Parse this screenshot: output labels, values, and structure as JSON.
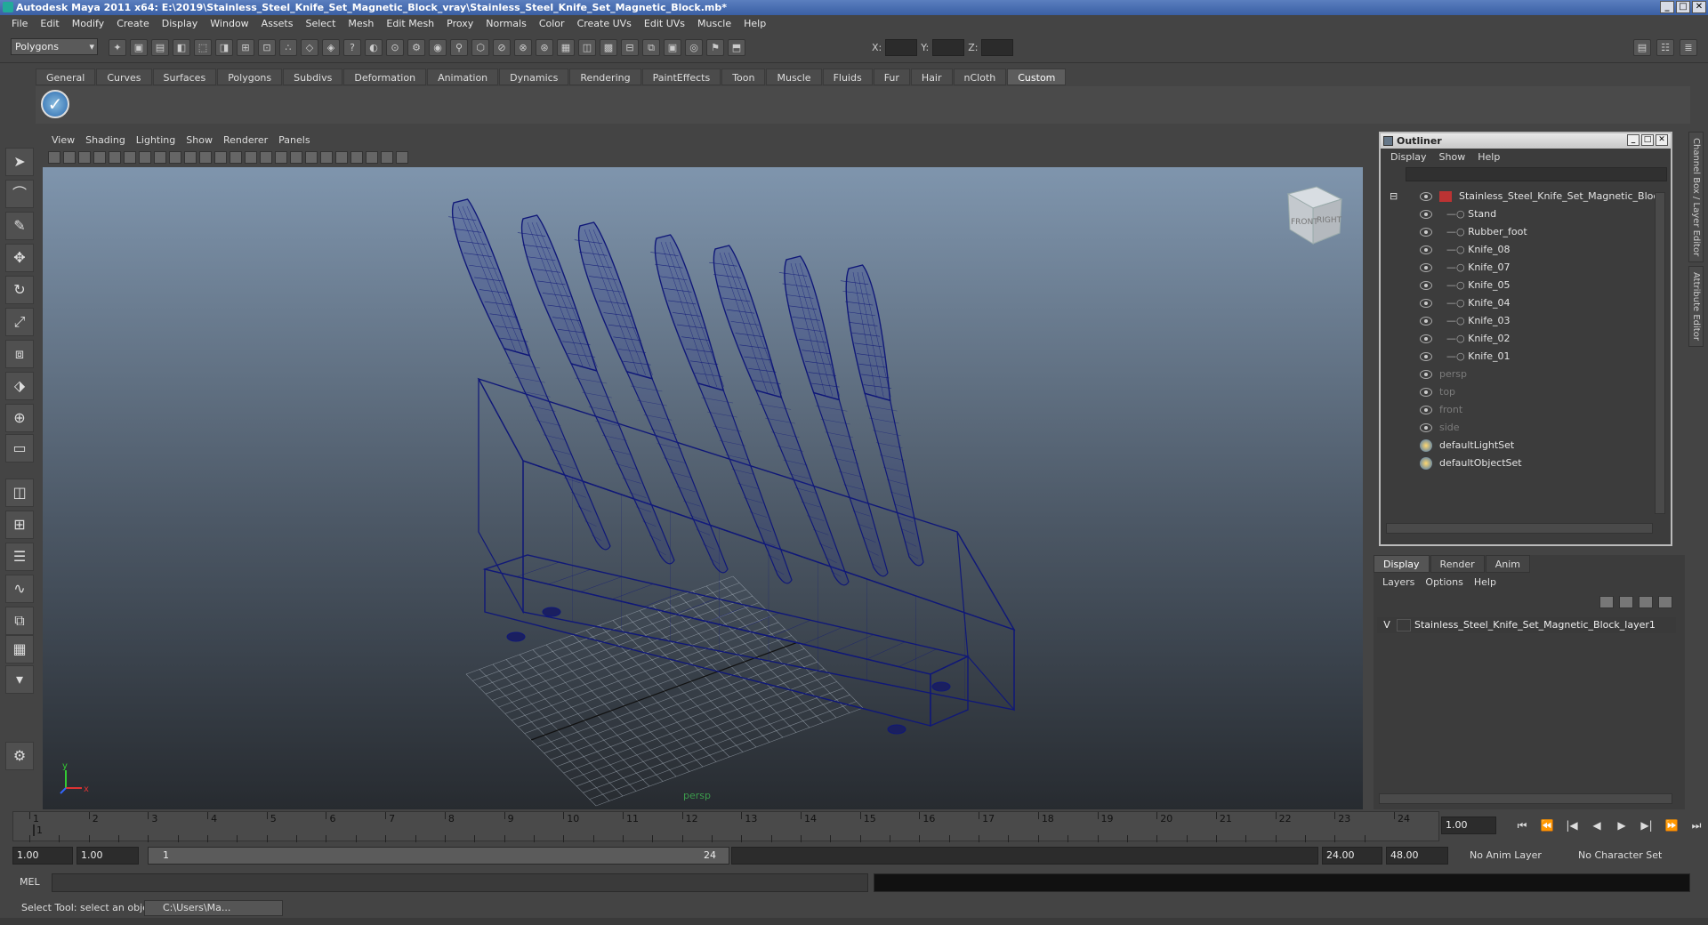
{
  "window": {
    "title": "Autodesk Maya 2011 x64: E:\\2019\\Stainless_Steel_Knife_Set_Magnetic_Block_vray\\Stainless_Steel_Knife_Set_Magnetic_Block.mb*"
  },
  "menubar": [
    "File",
    "Edit",
    "Modify",
    "Create",
    "Display",
    "Window",
    "Assets",
    "Select",
    "Mesh",
    "Edit Mesh",
    "Proxy",
    "Normals",
    "Color",
    "Create UVs",
    "Edit UVs",
    "Muscle",
    "Help"
  ],
  "toolbar": {
    "mode": "Polygons",
    "x_label": "X:",
    "y_label": "Y:",
    "z_label": "Z:"
  },
  "shelf_tabs": [
    {
      "label": "General",
      "active": false
    },
    {
      "label": "Curves",
      "active": false
    },
    {
      "label": "Surfaces",
      "active": false
    },
    {
      "label": "Polygons",
      "active": false
    },
    {
      "label": "Subdivs",
      "active": false
    },
    {
      "label": "Deformation",
      "active": false
    },
    {
      "label": "Animation",
      "active": false
    },
    {
      "label": "Dynamics",
      "active": false
    },
    {
      "label": "Rendering",
      "active": false
    },
    {
      "label": "PaintEffects",
      "active": false
    },
    {
      "label": "Toon",
      "active": false
    },
    {
      "label": "Muscle",
      "active": false
    },
    {
      "label": "Fluids",
      "active": false
    },
    {
      "label": "Fur",
      "active": false
    },
    {
      "label": "Hair",
      "active": false
    },
    {
      "label": "nCloth",
      "active": false
    },
    {
      "label": "Custom",
      "active": true
    }
  ],
  "panel_menu": [
    "View",
    "Shading",
    "Lighting",
    "Show",
    "Renderer",
    "Panels"
  ],
  "viewport": {
    "camera_label": "persp",
    "viewcube_front": "FRONT",
    "viewcube_right": "RIGHT",
    "wire_color": "#101878"
  },
  "outliner": {
    "title": "Outliner",
    "menu": [
      "Display",
      "Show",
      "Help"
    ],
    "items": [
      {
        "label": "Stainless_Steel_Knife_Set_Magnetic_Block",
        "type": "mesh",
        "dim": false
      },
      {
        "label": "Stand",
        "type": "child",
        "dim": false
      },
      {
        "label": "Rubber_foot",
        "type": "child",
        "dim": false
      },
      {
        "label": "Knife_08",
        "type": "child",
        "dim": false
      },
      {
        "label": "Knife_07",
        "type": "child",
        "dim": false
      },
      {
        "label": "Knife_05",
        "type": "child",
        "dim": false
      },
      {
        "label": "Knife_04",
        "type": "child",
        "dim": false
      },
      {
        "label": "Knife_03",
        "type": "child",
        "dim": false
      },
      {
        "label": "Knife_02",
        "type": "child",
        "dim": false
      },
      {
        "label": "Knife_01",
        "type": "child",
        "dim": false
      },
      {
        "label": "persp",
        "type": "camera",
        "dim": true
      },
      {
        "label": "top",
        "type": "camera",
        "dim": true
      },
      {
        "label": "front",
        "type": "camera",
        "dim": true
      },
      {
        "label": "side",
        "type": "camera",
        "dim": true
      },
      {
        "label": "defaultLightSet",
        "type": "set",
        "dim": false
      },
      {
        "label": "defaultObjectSet",
        "type": "set",
        "dim": false
      }
    ]
  },
  "layer_editor": {
    "tabs": [
      {
        "label": "Display",
        "active": true
      },
      {
        "label": "Render",
        "active": false
      },
      {
        "label": "Anim",
        "active": false
      }
    ],
    "menu": [
      "Layers",
      "Options",
      "Help"
    ],
    "layers": [
      {
        "visible": "V",
        "name": "Stainless_Steel_Knife_Set_Magnetic_Block_layer1"
      }
    ]
  },
  "side_tabs": [
    "Channel Box / Layer Editor",
    "Attribute Editor"
  ],
  "timeline": {
    "ticks": [
      "1",
      "2",
      "3",
      "4",
      "5",
      "6",
      "7",
      "8",
      "9",
      "10",
      "11",
      "12",
      "13",
      "14",
      "15",
      "16",
      "17",
      "18",
      "19",
      "20",
      "21",
      "22",
      "23",
      "24"
    ],
    "current_marker": "1",
    "current_frame": "1.00"
  },
  "range": {
    "start": "1.00",
    "playback_start": "1.00",
    "slider_start": "1",
    "slider_end": "24",
    "playback_end": "24.00",
    "end": "48.00",
    "anim_layer": "No Anim Layer",
    "character_set": "No Character Set"
  },
  "command_line": {
    "label": "MEL"
  },
  "status": {
    "help_line": "Select Tool: select an object",
    "task": "C:\\Users\\Ma..."
  }
}
